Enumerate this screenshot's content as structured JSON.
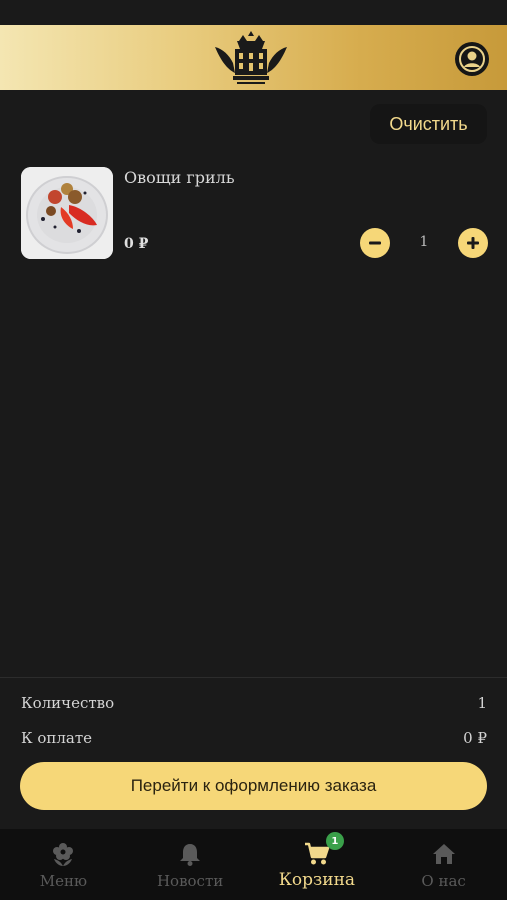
{
  "header": {
    "logo_icon": "crown-winged-logo-icon",
    "profile_icon": "user-profile-icon"
  },
  "cart": {
    "clear_label": "Очистить",
    "items": [
      {
        "name": "Овощи гриль",
        "price": "0 ₽",
        "quantity": "1",
        "image_icon": "grilled-vegetables-photo"
      }
    ]
  },
  "summary": {
    "quantity_label": "Количество",
    "quantity_value": "1",
    "pay_label": "К оплате",
    "pay_value": "0 ₽",
    "checkout_label": "Перейти к оформлению заказа"
  },
  "tabs": [
    {
      "label": "Меню",
      "icon": "flower-icon",
      "active": false
    },
    {
      "label": "Новости",
      "icon": "bell-icon",
      "active": false
    },
    {
      "label": "Корзина",
      "icon": "cart-icon",
      "active": true,
      "badge": "1"
    },
    {
      "label": "О нас",
      "icon": "home-icon",
      "active": false
    }
  ],
  "colors": {
    "background": "#1a1a1a",
    "accent": "#f6d778",
    "accent_text": "#f2d98c",
    "header_gradient_start": "#f4e6b2",
    "header_gradient_end": "#c79a3a",
    "badge": "#3aa04a",
    "tabbar": "#0f0f0f"
  }
}
